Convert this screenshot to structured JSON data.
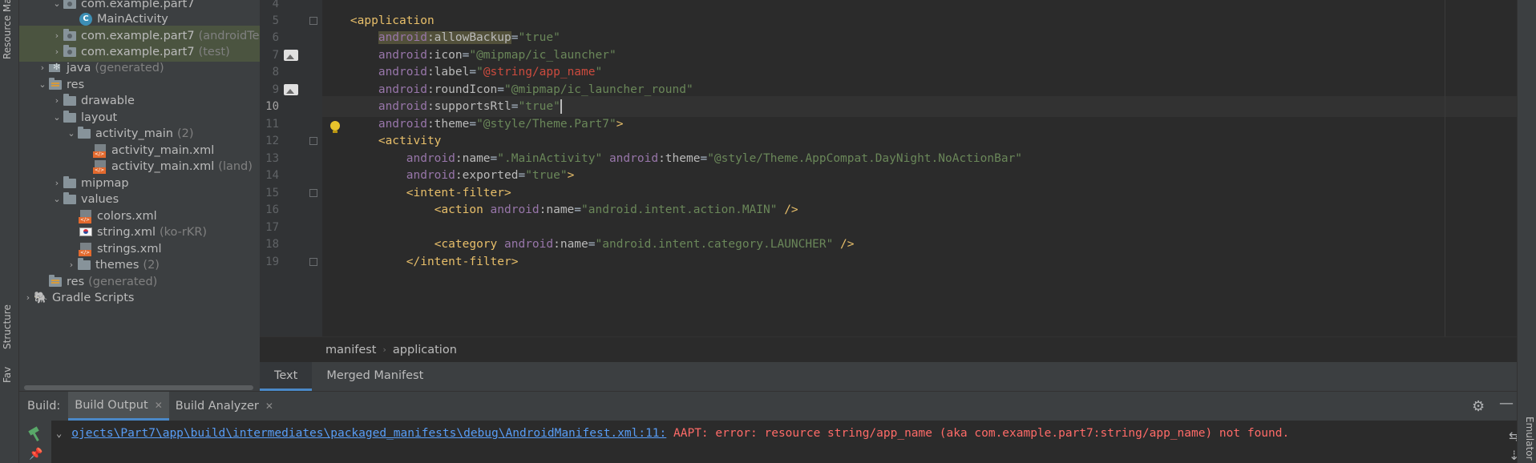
{
  "left_strip": {
    "resource_manager": "Resource Manager",
    "structure": "Structure",
    "favorites": "Favorites"
  },
  "right_strip": {
    "emulator": "Emulator"
  },
  "tree": [
    {
      "label": "com.example.part7",
      "suffix": ""
    },
    {
      "label": "MainActivity",
      "suffix": ""
    },
    {
      "label": "com.example.part7",
      "suffix": "(androidTest)"
    },
    {
      "label": "com.example.part7",
      "suffix": "(test)"
    },
    {
      "label": "java",
      "suffix": "(generated)"
    },
    {
      "label": "res",
      "suffix": ""
    },
    {
      "label": "drawable",
      "suffix": ""
    },
    {
      "label": "layout",
      "suffix": ""
    },
    {
      "label": "activity_main",
      "suffix": "(2)"
    },
    {
      "label": "activity_main.xml",
      "suffix": ""
    },
    {
      "label": "activity_main.xml",
      "suffix": "(land)"
    },
    {
      "label": "mipmap",
      "suffix": ""
    },
    {
      "label": "values",
      "suffix": ""
    },
    {
      "label": "colors.xml",
      "suffix": ""
    },
    {
      "label": "string.xml",
      "suffix": "(ko-rKR)"
    },
    {
      "label": "strings.xml",
      "suffix": ""
    },
    {
      "label": "themes",
      "suffix": "(2)"
    },
    {
      "label": "res",
      "suffix": "(generated)"
    },
    {
      "label": "Gradle Scripts",
      "suffix": ""
    }
  ],
  "line_numbers": [
    "4",
    "5",
    "6",
    "7",
    "8",
    "9",
    "10",
    "11",
    "12",
    "13",
    "14",
    "15",
    "16",
    "17",
    "18",
    "19"
  ],
  "code": {
    "l5_tag": "<application",
    "l6_ns": "android",
    "l6_attr": ":allowBackup",
    "l6_eq": "=",
    "l6_val": "\"true\"",
    "l7_ns": "android",
    "l7_attr": ":icon",
    "l7_eq": "=",
    "l7_val": "\"@mipmap/ic_launcher\"",
    "l8_ns": "android",
    "l8_attr": ":label",
    "l8_eq": "=",
    "l8_q1": "\"",
    "l8_val": "@string/app_name",
    "l8_q2": "\"",
    "l9_ns": "android",
    "l9_attr": ":roundIcon",
    "l9_eq": "=",
    "l9_val": "\"@mipmap/ic_launcher_round\"",
    "l10_ns": "android",
    "l10_attr": ":supportsRtl",
    "l10_eq": "=",
    "l10_val": "\"true\"",
    "l11_ns": "android",
    "l11_attr": ":theme",
    "l11_eq": "=",
    "l11_val": "\"@style/Theme.Part7\"",
    "l11_end": ">",
    "l12_tag": "<activity",
    "l13_ns": "android",
    "l13_attr": ":name",
    "l13_eq": "=",
    "l13_val": "\".MainActivity\"",
    "l13_ns2": "android",
    "l13_attr2": ":theme",
    "l13_eq2": "=",
    "l13_val2": "\"@style/Theme.AppCompat.DayNight.NoActionBar\"",
    "l14_ns": "android",
    "l14_attr": ":exported",
    "l14_eq": "=",
    "l14_val": "\"true\"",
    "l14_end": ">",
    "l15_tag": "<intent-filter>",
    "l16_tag": "<action",
    "l16_ns": "android",
    "l16_attr": ":name",
    "l16_eq": "=",
    "l16_val": "\"android.intent.action.MAIN\"",
    "l16_end": "/>",
    "l18_tag": "<category",
    "l18_ns": "android",
    "l18_attr": ":name",
    "l18_eq": "=",
    "l18_val": "\"android.intent.category.LAUNCHER\"",
    "l18_end": "/>",
    "l19_tag": "</intent-filter>"
  },
  "breadcrumb": [
    "manifest",
    "application"
  ],
  "editor_tabs": [
    "Text",
    "Merged Manifest"
  ],
  "build": {
    "label": "Build:",
    "tabs": [
      "Build Output",
      "Build Analyzer"
    ],
    "path": "ojects\\Part7\\app\\build\\intermediates\\packaged_manifests\\debug\\AndroidManifest.xml:11:",
    "error": "AAPT: error: resource string/app_name (aka com.example.part7:string/app_name) not found."
  },
  "colors": {
    "tag": "#e8bf6a",
    "namespace": "#9876aa",
    "attr_value": "#6a8759",
    "unresolved": "#cc4b3e",
    "link": "#589df6",
    "error": "#ff6b68",
    "accent": "#4a88c7"
  }
}
